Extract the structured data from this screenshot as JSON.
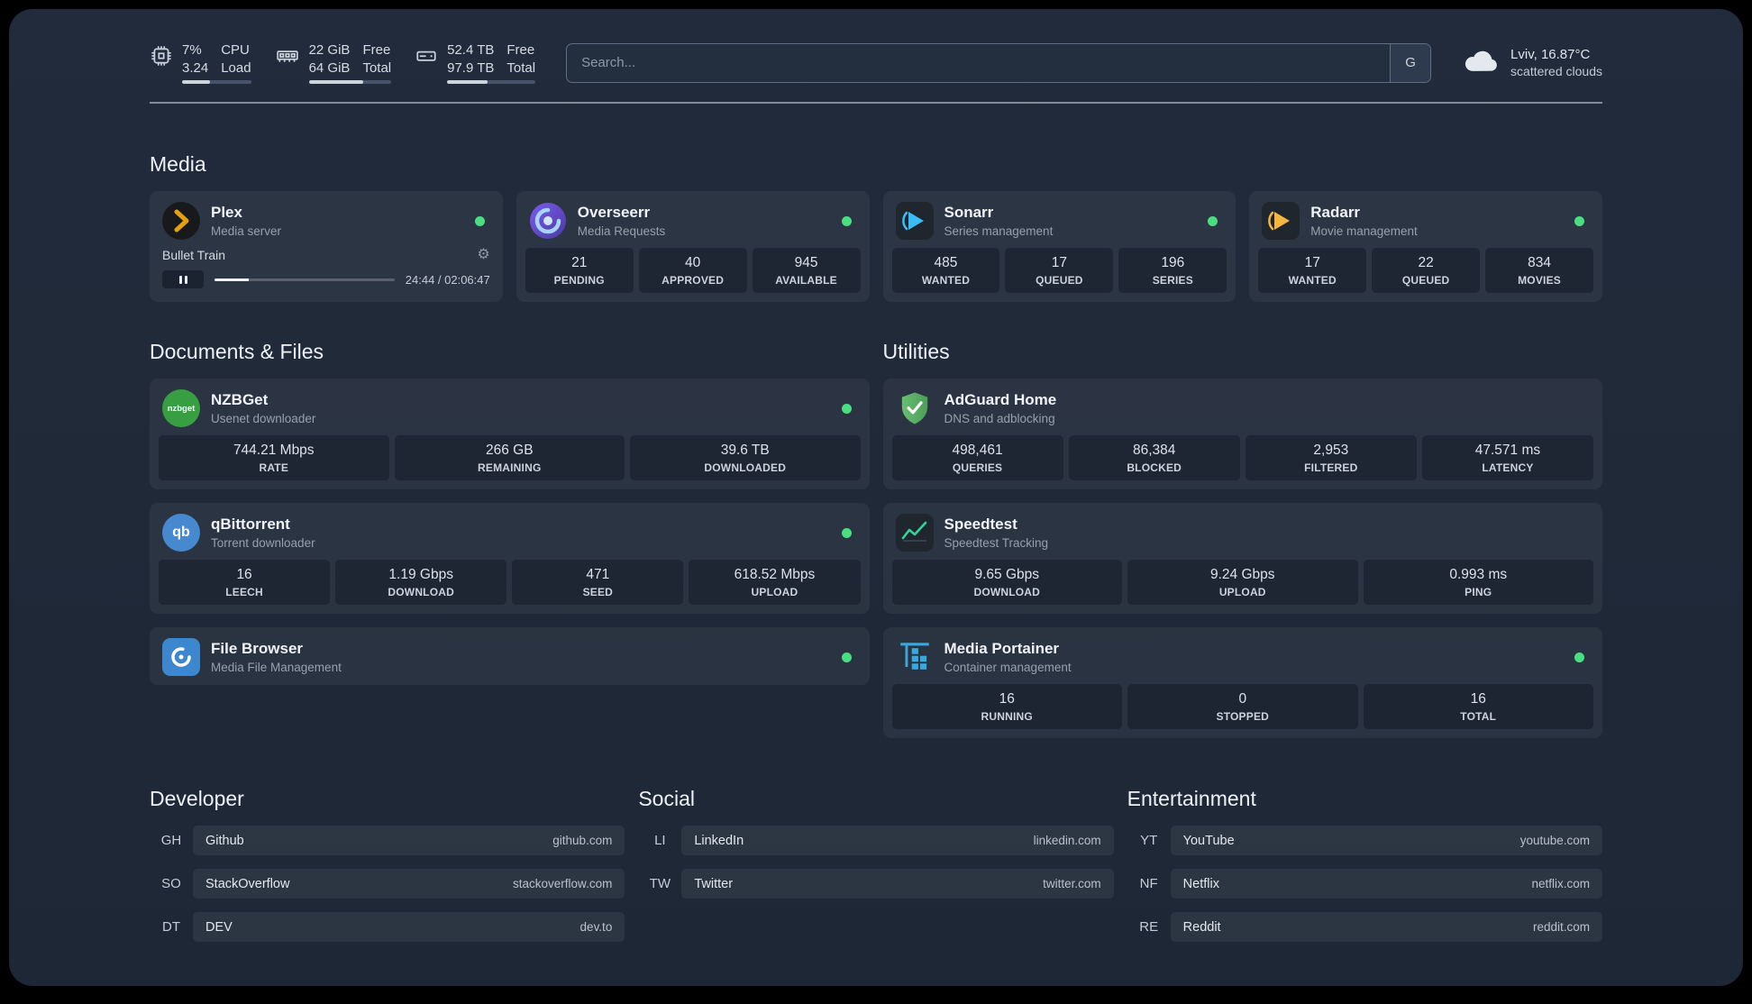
{
  "colors": {
    "background": "#1e2836",
    "status_online": "#4ade80",
    "plex_gold": "#e5a00d",
    "sonarr_blue": "#38bdf8",
    "radarr_gold": "#f4b63e",
    "adguard_green": "#62b565",
    "speedtest_green": "#34d399",
    "portainer_blue": "#3aa7dd"
  },
  "icons": {
    "settings_gear": "⚙"
  },
  "topbar": {
    "cpu": {
      "value_primary": "7%",
      "value_secondary": "3.24",
      "label_primary": "CPU",
      "label_secondary": "Load",
      "bar_percent": 40
    },
    "memory": {
      "value_primary": "22 GiB",
      "value_secondary": "64 GiB",
      "label_primary": "Free",
      "label_secondary": "Total",
      "bar_percent": 66
    },
    "disk": {
      "value_primary": "52.4 TB",
      "value_secondary": "97.9 TB",
      "label_primary": "Free",
      "label_secondary": "Total",
      "bar_percent": 46
    },
    "search": {
      "placeholder": "Search...",
      "provider_label": "G"
    },
    "weather": {
      "location": "Lviv, 16.87°C",
      "condition": "scattered clouds"
    }
  },
  "sections": {
    "media": "Media",
    "documents": "Documents & Files",
    "utilities": "Utilities"
  },
  "services": {
    "plex": {
      "title": "Plex",
      "subtitle": "Media server",
      "now_playing": {
        "track": "Bullet Train",
        "time": "24:44 / 02:06:47",
        "progress_percent": 19
      }
    },
    "overseerr": {
      "title": "Overseerr",
      "subtitle": "Media Requests",
      "stats": [
        {
          "value": "21",
          "label": "PENDING"
        },
        {
          "value": "40",
          "label": "APPROVED"
        },
        {
          "value": "945",
          "label": "AVAILABLE"
        }
      ]
    },
    "sonarr": {
      "title": "Sonarr",
      "subtitle": "Series management",
      "stats": [
        {
          "value": "485",
          "label": "WANTED"
        },
        {
          "value": "17",
          "label": "QUEUED"
        },
        {
          "value": "196",
          "label": "SERIES"
        }
      ]
    },
    "radarr": {
      "title": "Radarr",
      "subtitle": "Movie management",
      "stats": [
        {
          "value": "17",
          "label": "WANTED"
        },
        {
          "value": "22",
          "label": "QUEUED"
        },
        {
          "value": "834",
          "label": "MOVIES"
        }
      ]
    },
    "nzbget": {
      "title": "NZBGet",
      "subtitle": "Usenet downloader",
      "icon_text": "nzbget",
      "stats": [
        {
          "value": "744.21 Mbps",
          "label": "RATE"
        },
        {
          "value": "266 GB",
          "label": "REMAINING"
        },
        {
          "value": "39.6 TB",
          "label": "DOWNLOADED"
        }
      ]
    },
    "qbittorrent": {
      "title": "qBittorrent",
      "subtitle": "Torrent downloader",
      "icon_text": "qb",
      "stats": [
        {
          "value": "16",
          "label": "LEECH"
        },
        {
          "value": "1.19 Gbps",
          "label": "DOWNLOAD"
        },
        {
          "value": "471",
          "label": "SEED"
        },
        {
          "value": "618.52 Mbps",
          "label": "UPLOAD"
        }
      ]
    },
    "filebrowser": {
      "title": "File Browser",
      "subtitle": "Media File Management"
    },
    "adguard": {
      "title": "AdGuard Home",
      "subtitle": "DNS and adblocking",
      "stats": [
        {
          "value": "498,461",
          "label": "QUERIES"
        },
        {
          "value": "86,384",
          "label": "BLOCKED"
        },
        {
          "value": "2,953",
          "label": "FILTERED"
        },
        {
          "value": "47.571 ms",
          "label": "LATENCY"
        }
      ]
    },
    "speedtest": {
      "title": "Speedtest",
      "subtitle": "Speedtest Tracking",
      "stats": [
        {
          "value": "9.65 Gbps",
          "label": "DOWNLOAD"
        },
        {
          "value": "9.24 Gbps",
          "label": "UPLOAD"
        },
        {
          "value": "0.993 ms",
          "label": "PING"
        }
      ]
    },
    "portainer": {
      "title": "Media Portainer",
      "subtitle": "Container management",
      "stats": [
        {
          "value": "16",
          "label": "RUNNING"
        },
        {
          "value": "0",
          "label": "STOPPED"
        },
        {
          "value": "16",
          "label": "TOTAL"
        }
      ]
    }
  },
  "bookmarks": [
    {
      "title": "Developer",
      "items": [
        {
          "abbr": "GH",
          "name": "Github",
          "domain": "github.com"
        },
        {
          "abbr": "SO",
          "name": "StackOverflow",
          "domain": "stackoverflow.com"
        },
        {
          "abbr": "DT",
          "name": "DEV",
          "domain": "dev.to"
        }
      ]
    },
    {
      "title": "Social",
      "items": [
        {
          "abbr": "LI",
          "name": "LinkedIn",
          "domain": "linkedin.com"
        },
        {
          "abbr": "TW",
          "name": "Twitter",
          "domain": "twitter.com"
        }
      ]
    },
    {
      "title": "Entertainment",
      "items": [
        {
          "abbr": "YT",
          "name": "YouTube",
          "domain": "youtube.com"
        },
        {
          "abbr": "NF",
          "name": "Netflix",
          "domain": "netflix.com"
        },
        {
          "abbr": "RE",
          "name": "Reddit",
          "domain": "reddit.com"
        }
      ]
    }
  ]
}
